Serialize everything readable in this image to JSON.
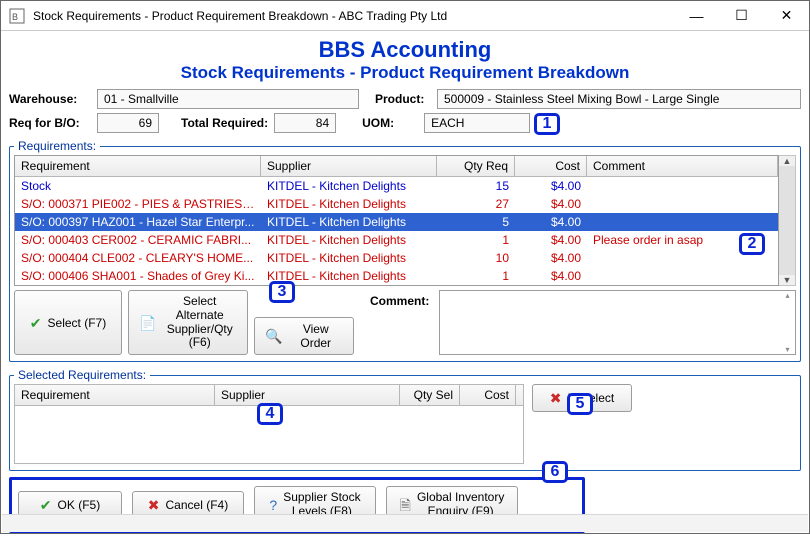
{
  "titlebar": {
    "title": "Stock Requirements - Product Requirement Breakdown - ABC Trading Pty Ltd"
  },
  "header": {
    "app_name": "BBS Accounting",
    "screen_title": "Stock Requirements - Product Requirement Breakdown"
  },
  "fields": {
    "warehouse_label": "Warehouse:",
    "warehouse_value": "01 - Smallville",
    "product_label": "Product:",
    "product_value": "500009 - Stainless Steel Mixing Bowl - Large Single",
    "req_bo_label": "Req for B/O:",
    "req_bo_value": "69",
    "total_required_label": "Total Required:",
    "total_required_value": "84",
    "uom_label": "UOM:",
    "uom_value": "EACH"
  },
  "requirements": {
    "legend": "Requirements:",
    "columns": {
      "requirement": "Requirement",
      "supplier": "Supplier",
      "qty": "Qty Req",
      "cost": "Cost",
      "comment": "Comment"
    },
    "rows": [
      {
        "style": "blue",
        "requirement": "Stock",
        "supplier": "KITDEL - Kitchen Delights",
        "qty": "15",
        "cost": "$4.00",
        "comment": ""
      },
      {
        "style": "red",
        "requirement": "S/O: 000371 PIE002 - PIES & PASTRIES ...",
        "supplier": "KITDEL - Kitchen Delights",
        "qty": "27",
        "cost": "$4.00",
        "comment": ""
      },
      {
        "style": "sel",
        "requirement": "S/O: 000397 HAZ001 - Hazel Star Enterpr...",
        "supplier": "KITDEL - Kitchen Delights",
        "qty": "5",
        "cost": "$4.00",
        "comment": ""
      },
      {
        "style": "red",
        "requirement": "S/O: 000403 CER002 - CERAMIC FABRI...",
        "supplier": "KITDEL - Kitchen Delights",
        "qty": "1",
        "cost": "$4.00",
        "comment": "Please order in asap"
      },
      {
        "style": "red",
        "requirement": "S/O: 000404 CLE002 - CLEARY'S HOME...",
        "supplier": "KITDEL - Kitchen Delights",
        "qty": "10",
        "cost": "$4.00",
        "comment": ""
      },
      {
        "style": "red",
        "requirement": "S/O: 000406 SHA001 - Shades of Grey Ki...",
        "supplier": "KITDEL - Kitchen Delights",
        "qty": "1",
        "cost": "$4.00",
        "comment": ""
      }
    ],
    "buttons": {
      "select": "Select (F7)",
      "alt_supplier": "Select Alternate\nSupplier/Qty (F6)",
      "view_order": "View Order",
      "comment_label": "Comment:"
    }
  },
  "selected": {
    "legend": "Selected Requirements:",
    "columns": {
      "requirement": "Requirement",
      "supplier": "Supplier",
      "qty": "Qty Sel",
      "cost": "Cost"
    },
    "deselect": "Deselect"
  },
  "bottom": {
    "ok": "OK (F5)",
    "cancel": "Cancel (F4)",
    "supplier_stock": "Supplier Stock\nLevels (F8)",
    "global_inv": "Global Inventory\nEnquiry (F9)"
  },
  "annotations": {
    "a1": "1",
    "a2": "2",
    "a3": "3",
    "a4": "4",
    "a5": "5",
    "a6": "6"
  }
}
